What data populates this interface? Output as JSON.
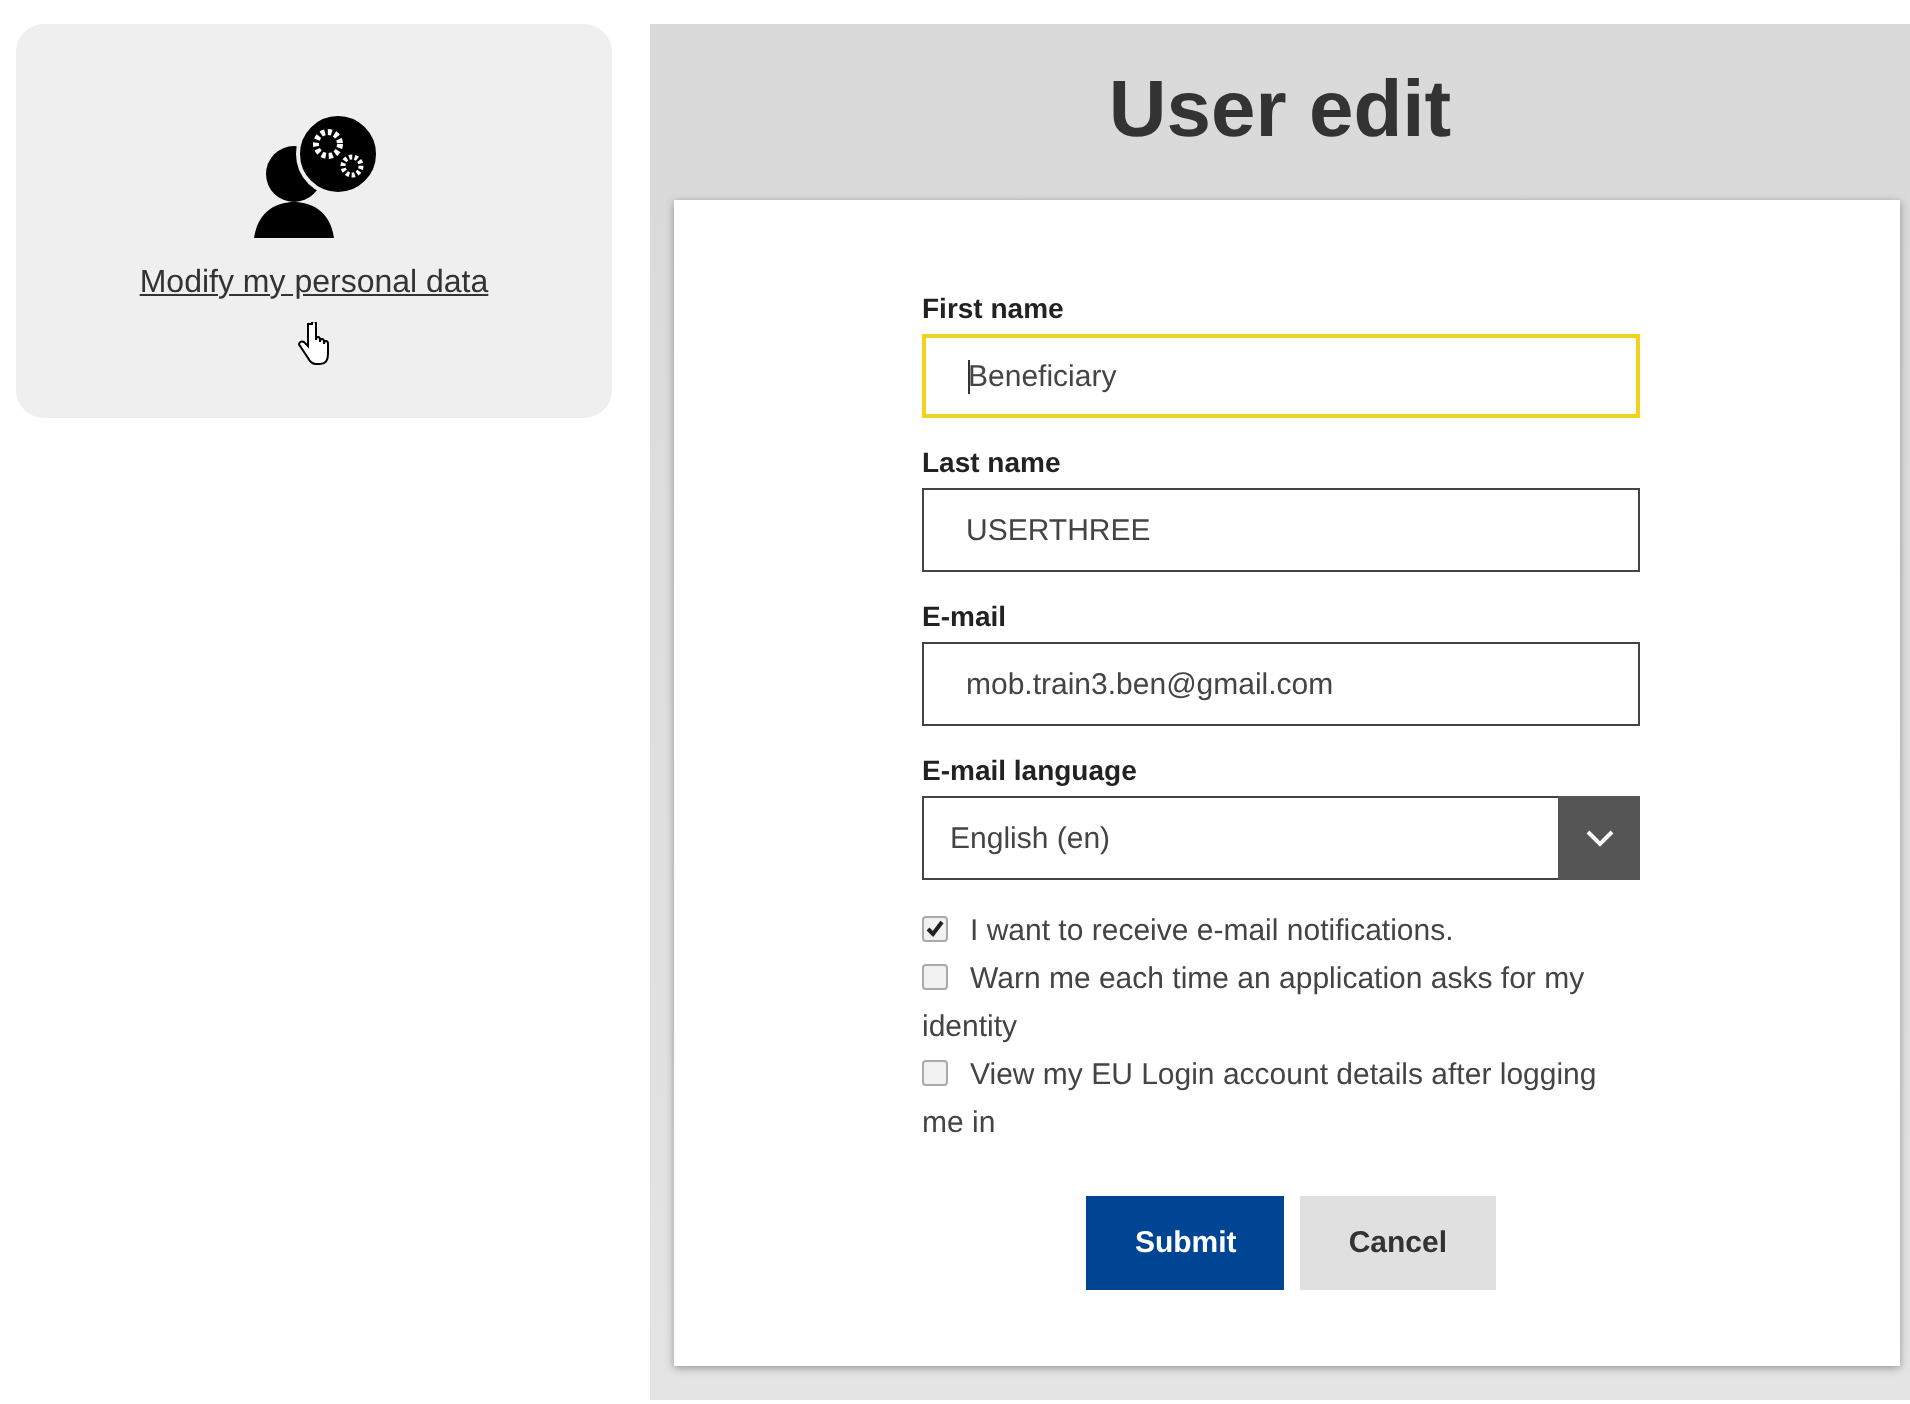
{
  "shortcut": {
    "label": "Modify my personal data"
  },
  "title": "User edit",
  "fields": [
    {
      "kind": "text",
      "label": "First name",
      "value": "Beneficiary",
      "focused": true
    },
    {
      "kind": "text",
      "label": "Last name",
      "value": "USERTHREE",
      "focused": false
    },
    {
      "kind": "text",
      "label": "E-mail",
      "value": "mob.train3.ben@gmail.com",
      "focused": false
    },
    {
      "kind": "select",
      "label": "E-mail language",
      "value": "English (en)",
      "focused": false
    }
  ],
  "options": [
    {
      "label": "I want to receive e-mail notifications.",
      "checked": true
    },
    {
      "label": "Warn me each time an application asks for my identity",
      "checked": false
    },
    {
      "label": "View my EU Login account details after logging me in",
      "checked": false
    }
  ],
  "buttons": [
    {
      "label": "Submit",
      "kind": "primary"
    },
    {
      "label": "Cancel",
      "kind": "secondary"
    }
  ]
}
